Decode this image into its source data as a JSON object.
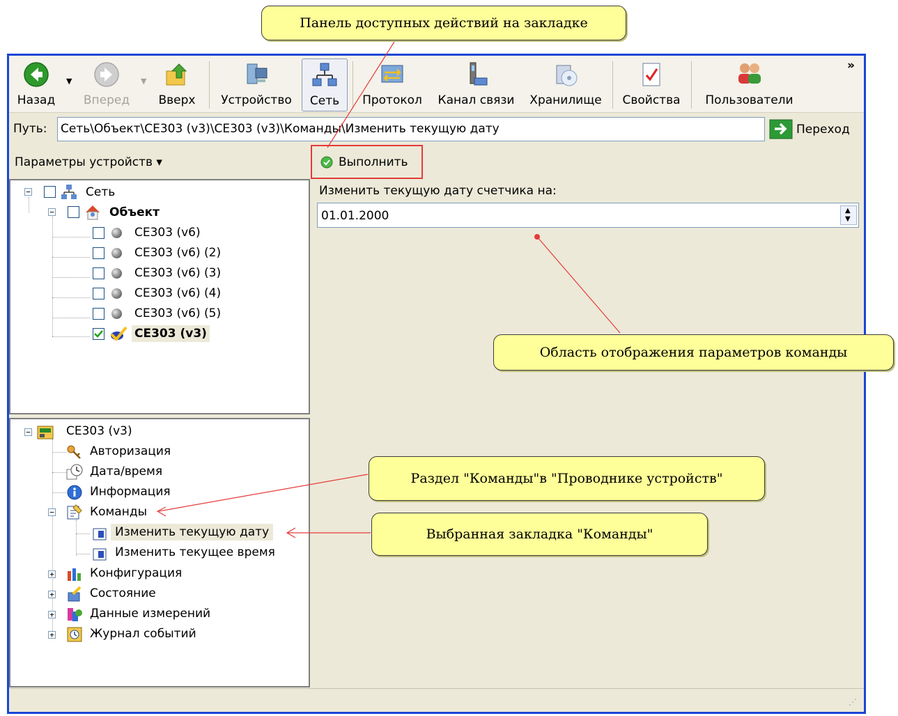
{
  "toolbar": {
    "back": "Назад",
    "forward": "Вперед",
    "up": "Вверх",
    "device": "Устройство",
    "network": "Сеть",
    "protocol": "Протокол",
    "channel": "Канал связи",
    "storage": "Хранилище",
    "properties": "Свойства",
    "users": "Пользователи",
    "overflow": "»"
  },
  "path": {
    "label": "Путь:",
    "value": "Сеть\\Объект\\СЕ303 (v3)\\СЕ303 (v3)\\Команды\\Изменить текущую дату",
    "go_label": "Переход"
  },
  "action_bar": {
    "params_label": "Параметры устройств ▾",
    "execute_label": "Выполнить"
  },
  "tree_network": {
    "root": "Сеть",
    "object": "Объект",
    "devices": [
      "СЕ303 (v6)",
      "СЕ303 (v6) (2)",
      "СЕ303 (v6) (3)",
      "СЕ303 (v6) (4)",
      "СЕ303 (v6) (5)"
    ],
    "selected_device": "СЕ303 (v3)"
  },
  "tree_device": {
    "root": "СЕ303 (v3)",
    "auth": "Авторизация",
    "datetime": "Дата/время",
    "info": "Информация",
    "commands": "Команды",
    "cmd_date": "Изменить текущую дату",
    "cmd_time": "Изменить текущее время",
    "config": "Конфигурация",
    "state": "Состояние",
    "measurements": "Данные измерений",
    "events": "Журнал событий"
  },
  "command_panel": {
    "label": "Изменить текущую дату счетчика на:",
    "date_value": "01.01.2000"
  },
  "callouts": {
    "top": "Панель доступных действий на закладке",
    "params_area": "Область отображения параметров команды",
    "commands_section": "Раздел \"Команды\"в \"Проводнике устройств\"",
    "selected_tab": "Выбранная закладка \"Команды\""
  },
  "colors": {
    "window_border": "#1a46d6",
    "callout_fill": "#ffff99",
    "annotation_red": "#e53a3a"
  }
}
